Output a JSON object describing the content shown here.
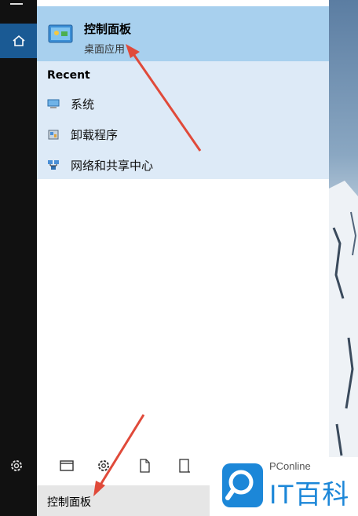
{
  "best_match": {
    "title": "控制面板",
    "subtitle": "桌面应用"
  },
  "recent": {
    "heading": "Recent",
    "items": [
      {
        "label": "系统",
        "icon": "system-icon"
      },
      {
        "label": "卸载程序",
        "icon": "uninstall-icon"
      },
      {
        "label": "网络和共享中心",
        "icon": "network-icon"
      }
    ]
  },
  "search": {
    "query": "控制面板"
  },
  "filters": [
    "apps-filter-icon",
    "settings-filter-icon",
    "documents-filter-icon",
    "folders-filter-icon"
  ],
  "watermark": {
    "site": "PConline",
    "brand": "IT百科"
  },
  "colors": {
    "selected_bg": "#a8d0ee",
    "recent_bg": "#ddeaf7",
    "rail_bg": "#111111",
    "home_bg": "#1a5a94",
    "arrow": "#e04a3a",
    "brand": "#1c87d8"
  }
}
